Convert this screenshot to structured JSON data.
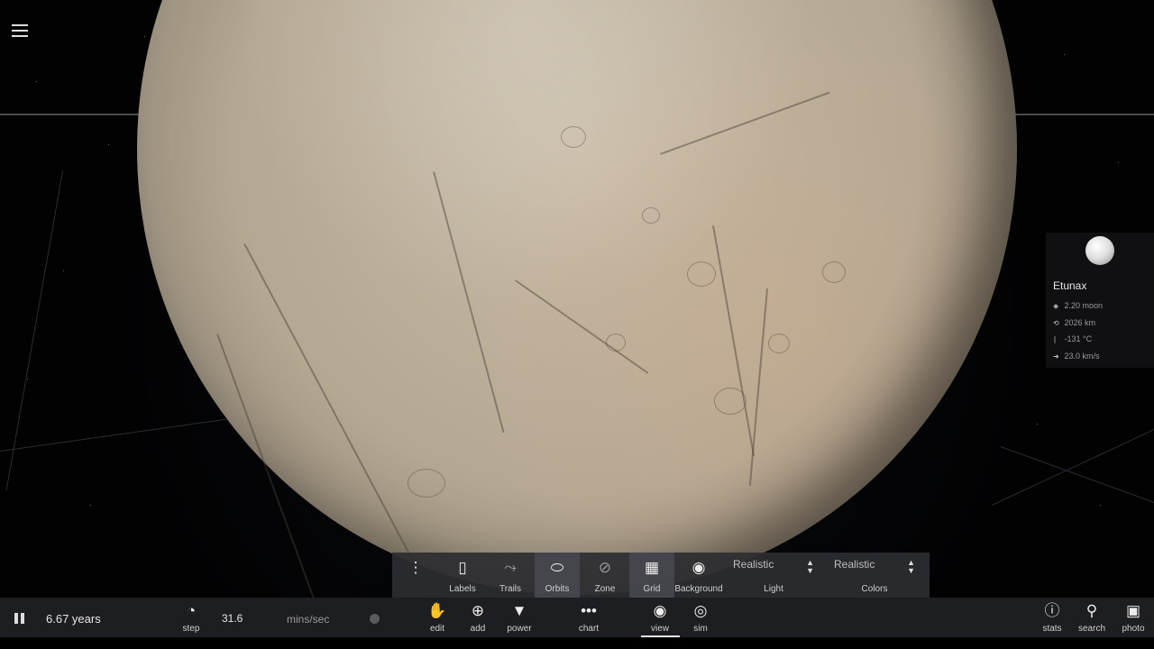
{
  "menu": {
    "icon": "hamburger-menu-icon"
  },
  "selected_body": {
    "name": "Etunax",
    "stats": [
      {
        "icon": "mass-icon",
        "text": "2.20 moon"
      },
      {
        "icon": "radius-icon",
        "text": "2026 km"
      },
      {
        "icon": "temperature-icon",
        "text": "-131 °C"
      },
      {
        "icon": "velocity-icon",
        "text": "23.0 km/s"
      }
    ]
  },
  "view_toolbar": {
    "items": [
      {
        "label": "Labels",
        "icon": "label-tag-icon"
      },
      {
        "label": "Trails",
        "icon": "trails-icon"
      },
      {
        "label": "Orbits",
        "icon": "orbits-icon"
      },
      {
        "label": "Zone",
        "icon": "zone-icon"
      },
      {
        "label": "Grid",
        "icon": "grid-icon"
      },
      {
        "label": "Background",
        "icon": "palette-icon"
      }
    ],
    "light": {
      "value": "Realistic",
      "label": "Light"
    },
    "colors": {
      "value": "Realistic",
      "label": "Colors"
    }
  },
  "bottom_bar": {
    "time": "6.67 years",
    "step_label": "step",
    "speed_value": "31.6",
    "speed_unit": "mins/sec",
    "tools": [
      {
        "label": "edit",
        "icon": "hand-icon"
      },
      {
        "label": "add",
        "icon": "add-circle-icon"
      },
      {
        "label": "power",
        "icon": "power-icon"
      },
      {
        "label": "chart",
        "icon": "chart-icon"
      },
      {
        "label": "view",
        "icon": "eye-icon"
      },
      {
        "label": "sim",
        "icon": "sim-icon"
      }
    ],
    "right_tools": [
      {
        "label": "stats",
        "icon": "info-icon"
      },
      {
        "label": "search",
        "icon": "search-icon"
      },
      {
        "label": "photo",
        "icon": "camera-icon"
      }
    ]
  }
}
